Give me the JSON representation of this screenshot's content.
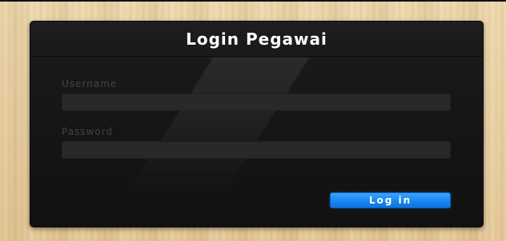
{
  "login_panel": {
    "title": "Login Pegawai",
    "username_label": "Username",
    "username_value": "",
    "password_label": "Password",
    "password_value": "",
    "login_button_label": "Log in"
  },
  "colors": {
    "panel_background": "#161617",
    "button_accent": "#1a86f0",
    "label_text": "#444448",
    "background_wood": "#e9d2a6"
  }
}
